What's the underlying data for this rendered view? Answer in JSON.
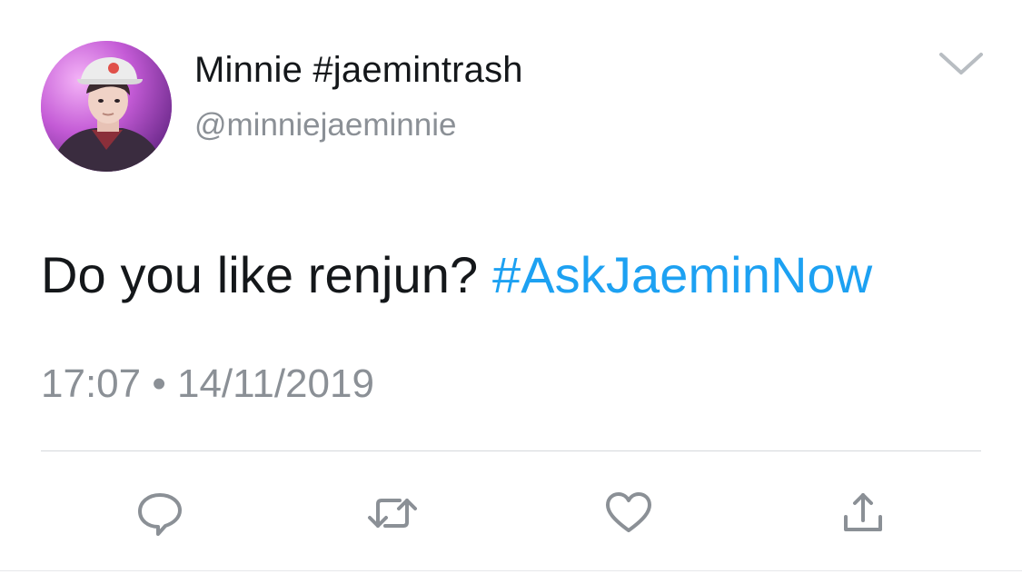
{
  "tweet": {
    "display_name": "Minnie #jaemintrash",
    "handle": "@minniejaeminnie",
    "text_plain": "Do you like renjun? ",
    "text_hashtag": "#AskJaeminNow",
    "time": "17:07",
    "separator": "•",
    "date": "14/11/2019"
  },
  "icons": {
    "menu": "chevron-down-icon",
    "reply": "reply-icon",
    "retweet": "retweet-icon",
    "like": "heart-icon",
    "share": "share-icon"
  },
  "colors": {
    "text": "#14171a",
    "muted": "#8b9096",
    "hashtag": "#1da1f2",
    "icon": "#8b9096"
  }
}
